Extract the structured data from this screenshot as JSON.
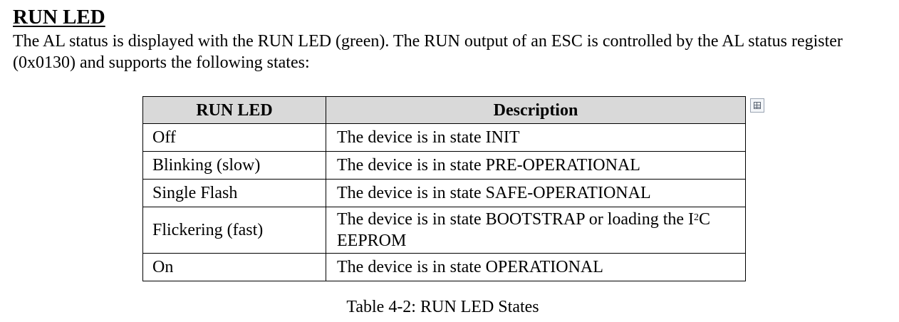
{
  "heading": "RUN LED",
  "intro": "The AL status is displayed with the RUN LED (green). The RUN output of an ESC is controlled by the AL status register (0x0130) and supports the following states:",
  "table": {
    "headers": [
      "RUN LED",
      "Description"
    ],
    "rows": [
      {
        "led": "Off",
        "desc": "The device is in state INIT"
      },
      {
        "led": "Blinking (slow)",
        "desc": "The device is in state PRE-OPERATIONAL"
      },
      {
        "led": "Single Flash",
        "desc": "The device is in state SAFE-OPERATIONAL"
      },
      {
        "led": "Flickering (fast)",
        "desc_pre": "The device is in state BOOTSTRAP or loading the I",
        "desc_sup": "2",
        "desc_post": "C EEPROM"
      },
      {
        "led": "On",
        "desc": "The device is in state OPERATIONAL"
      }
    ]
  },
  "caption": "Table 4-2: RUN LED States",
  "icons": {
    "table_anchor": "table-anchor-icon"
  }
}
